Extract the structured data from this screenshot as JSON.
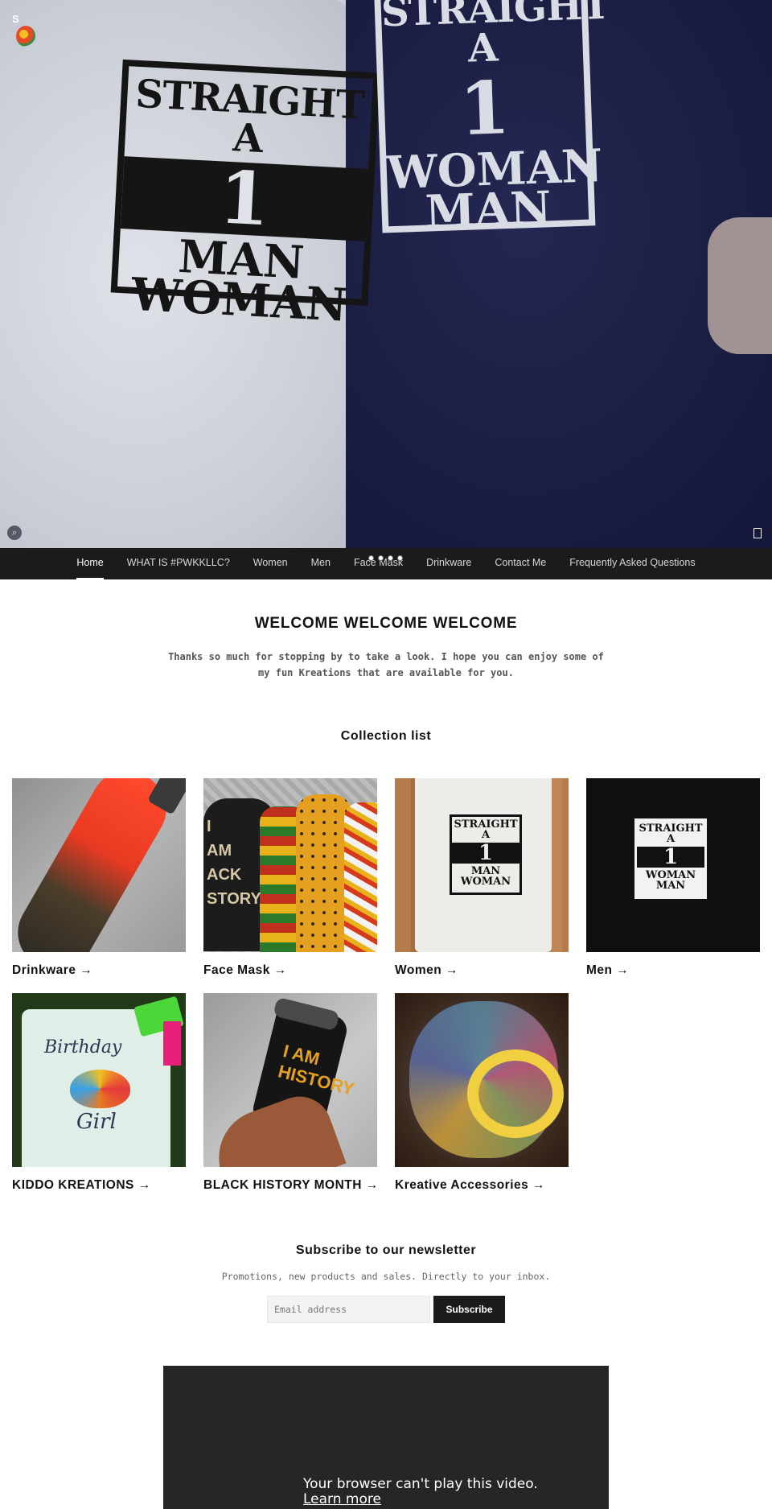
{
  "hero": {
    "logo_letter": "S",
    "print_left": {
      "top": "STRAIGHT A",
      "num": "1",
      "bot1": "MAN",
      "bot2": "WOMAN"
    },
    "print_right": {
      "top": "STRAIGHT A",
      "num": "1",
      "bot1": "WOMAN",
      "bot2": "MAN"
    },
    "search_icon": "search-icon",
    "cart_icon": "cart-icon",
    "slide_count": 4
  },
  "nav": {
    "items": [
      {
        "label": "Home",
        "active": true
      },
      {
        "label": "WHAT IS #PWKKLLC?"
      },
      {
        "label": "Women"
      },
      {
        "label": "Men"
      },
      {
        "label": "Face Mask"
      },
      {
        "label": "Drinkware"
      },
      {
        "label": "Contact Me"
      },
      {
        "label": "Frequently Asked Questions"
      }
    ]
  },
  "welcome": {
    "title": "WELCOME WELCOME WELCOME",
    "text": "Thanks so much for stopping by to take a look. I hope you can enjoy some of my fun Kreations that are available for you."
  },
  "collection": {
    "title": "Collection list",
    "items": [
      {
        "label": "Drinkware →"
      },
      {
        "label": "Face Mask →",
        "image_text": "I\nAM\nACK\nSTORY"
      },
      {
        "label": "Women →",
        "print": {
          "top": "STRAIGHT A",
          "num": "1",
          "bot1": "MAN",
          "bot2": "WOMAN"
        }
      },
      {
        "label": "Men →",
        "print": {
          "top": "STRAIGHT A",
          "num": "1",
          "bot1": "WOMAN",
          "bot2": "MAN"
        }
      },
      {
        "label": "KIDDO KREATIONS →",
        "image_text": {
          "top": "Birthday",
          "bottom": "Girl"
        }
      },
      {
        "label": "BLACK HISTORY MONTH →",
        "image_text": "I AM\nHISTORY"
      },
      {
        "label": "Kreative Accessories →"
      }
    ]
  },
  "newsletter": {
    "title": "Subscribe to our newsletter",
    "text": "Promotions, new products and sales. Directly to your inbox.",
    "email_placeholder": "Email address",
    "button_label": "Subscribe"
  },
  "video": {
    "message": "Your browser can't play this video.",
    "link_label": "Learn more"
  }
}
